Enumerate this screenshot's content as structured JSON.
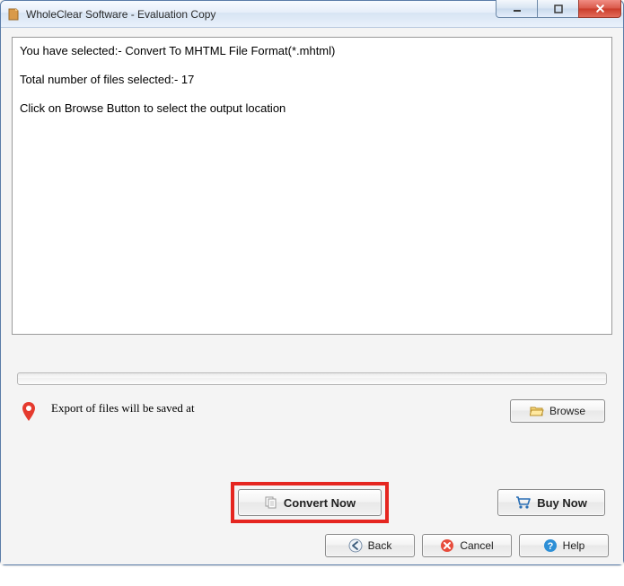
{
  "window": {
    "title": "WholeClear Software - Evaluation Copy"
  },
  "info": {
    "line1": "You have selected:- Convert To MHTML File Format(*.mhtml)",
    "line2": "Total number of files selected:- 17",
    "line3": "Click on Browse Button to select the output location"
  },
  "export": {
    "label": "Export of files will be saved at",
    "browse_label": "Browse"
  },
  "actions": {
    "convert_label": "Convert Now",
    "buynow_label": "Buy Now"
  },
  "footer": {
    "back": "Back",
    "cancel": "Cancel",
    "help": "Help"
  }
}
